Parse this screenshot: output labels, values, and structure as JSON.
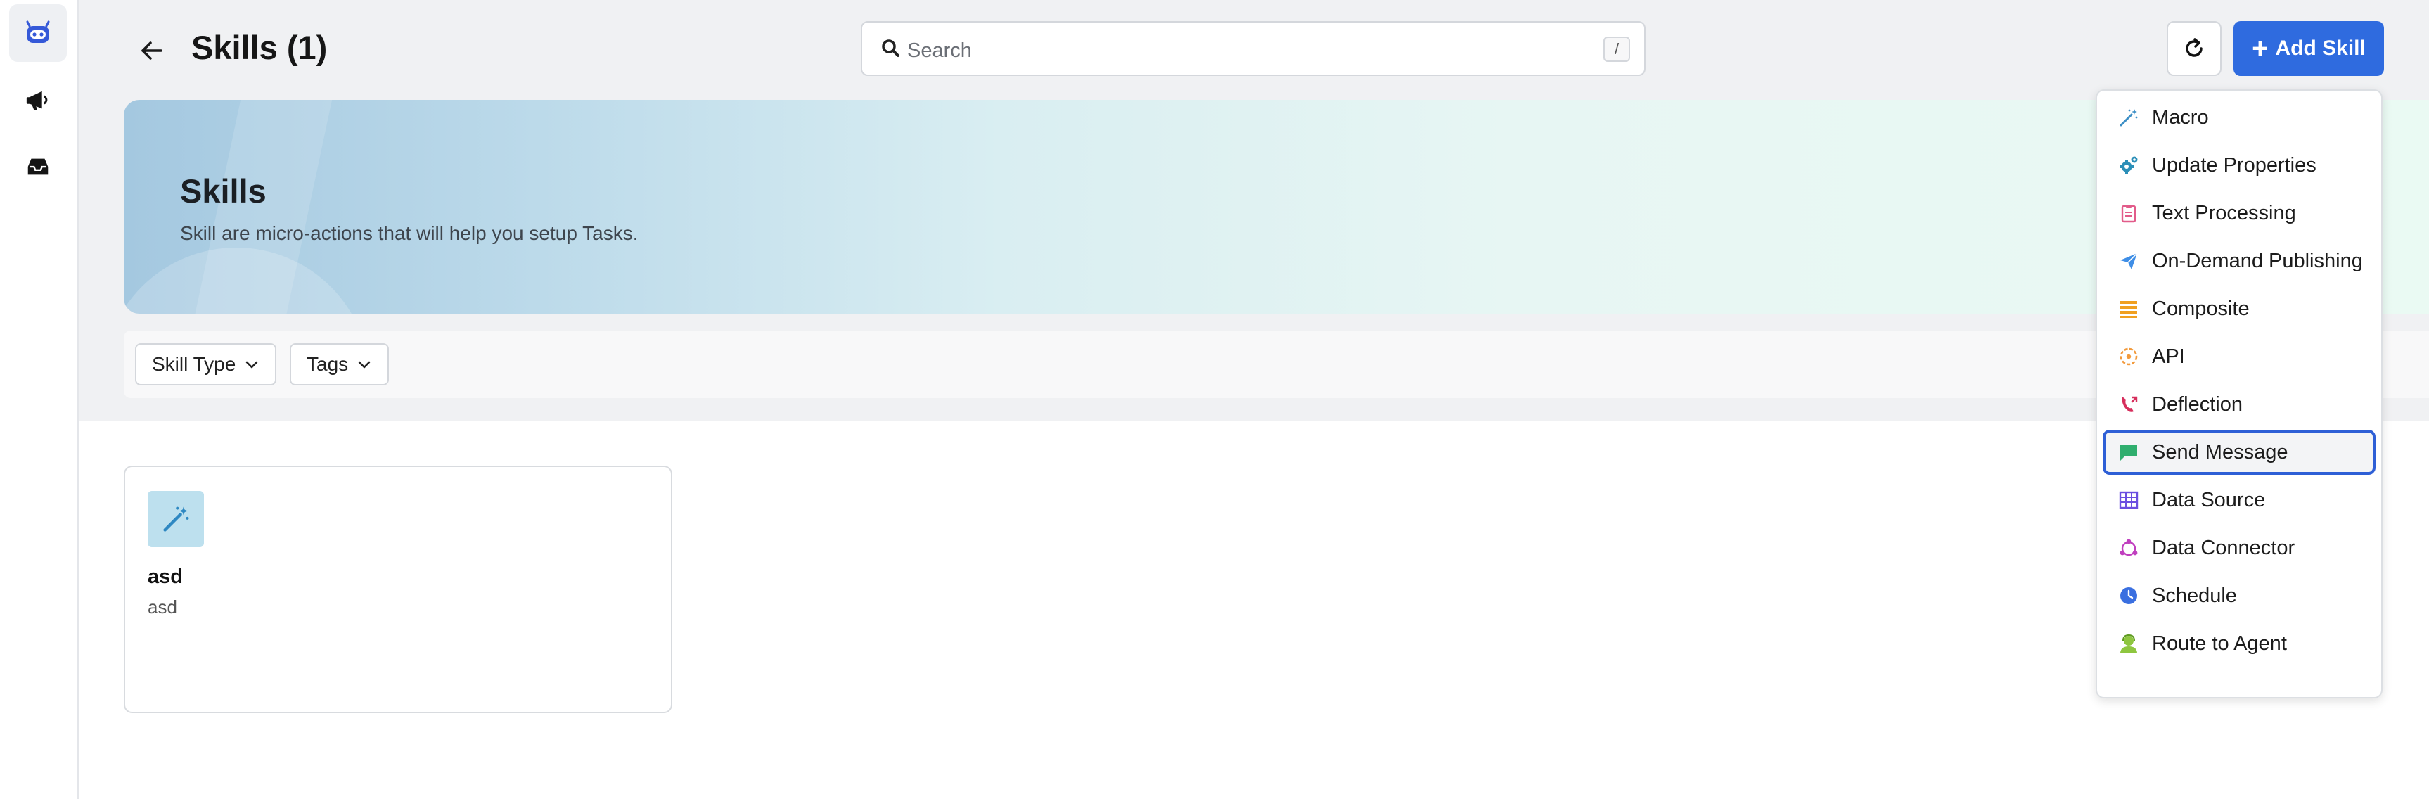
{
  "header": {
    "title": "Skills (1)",
    "search_placeholder": "Search",
    "search_shortcut": "/",
    "add_label": "Add Skill"
  },
  "banner": {
    "title": "Skills",
    "subtitle": "Skill are micro-actions that will help you setup Tasks."
  },
  "filters": [
    {
      "label": "Skill Type"
    },
    {
      "label": "Tags"
    }
  ],
  "skills": [
    {
      "name": "asd",
      "description": "asd",
      "icon": "wand-icon"
    }
  ],
  "dropdown": {
    "items": [
      {
        "label": "Macro",
        "icon": "wand-icon",
        "color": "#3d8fc6"
      },
      {
        "label": "Update Properties",
        "icon": "gears-icon",
        "color": "#2b8fb8"
      },
      {
        "label": "Text Processing",
        "icon": "clipboard-icon",
        "color": "#e25c8a"
      },
      {
        "label": "On-Demand Publishing",
        "icon": "paper-plane-icon",
        "color": "#3f8ee6"
      },
      {
        "label": "Composite",
        "icon": "layers-icon",
        "color": "#f0a020"
      },
      {
        "label": "API",
        "icon": "api-icon",
        "color": "#f29a3c"
      },
      {
        "label": "Deflection",
        "icon": "deflection-icon",
        "color": "#d62e5c"
      },
      {
        "label": "Send Message",
        "icon": "message-icon",
        "color": "#2fae6e"
      },
      {
        "label": "Data Source",
        "icon": "grid-icon",
        "color": "#6a4ee0"
      },
      {
        "label": "Data Connector",
        "icon": "connector-icon",
        "color": "#c03fbf"
      },
      {
        "label": "Schedule",
        "icon": "clock-icon",
        "color": "#3a6fe0"
      },
      {
        "label": "Route to Agent",
        "icon": "agent-icon",
        "color": "#8ec63f"
      }
    ],
    "selected": "Send Message"
  },
  "colors": {
    "accent": "#2f6bdf",
    "selected_border": "#2e5fd6"
  }
}
